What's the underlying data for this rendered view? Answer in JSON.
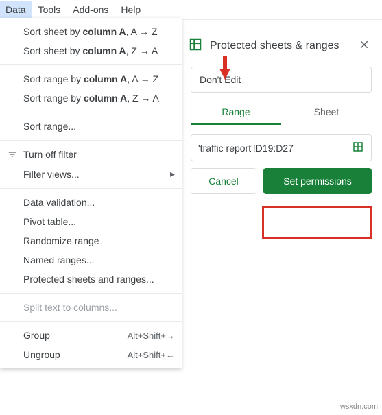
{
  "menubar": {
    "data": "Data",
    "tools": "Tools",
    "addons": "Add-ons",
    "help": "Help"
  },
  "menu": {
    "sort_sheet_az_pre": "Sort sheet by ",
    "sort_sheet_az_col": "column A",
    "sort_sheet_az_suf": ", A → Z",
    "sort_sheet_za_pre": "Sort sheet by ",
    "sort_sheet_za_col": "column A",
    "sort_sheet_za_suf": ", Z → A",
    "sort_range_az_pre": "Sort range by ",
    "sort_range_az_col": "column A",
    "sort_range_az_suf": ", A → Z",
    "sort_range_za_pre": "Sort range by ",
    "sort_range_za_col": "column A",
    "sort_range_za_suf": ", Z → A",
    "sort_range": "Sort range...",
    "turn_off_filter": "Turn off filter",
    "filter_views": "Filter views...",
    "data_validation": "Data validation...",
    "pivot_table": "Pivot table...",
    "randomize_range": "Randomize range",
    "named_ranges": "Named ranges...",
    "protected_sheets": "Protected sheets and ranges...",
    "split_text": "Split text to columns...",
    "group": "Group",
    "group_shortcut": "Alt+Shift+→",
    "ungroup": "Ungroup",
    "ungroup_shortcut": "Alt+Shift+←"
  },
  "panel": {
    "title": "Protected sheets & ranges",
    "description": "Don't Edit",
    "tab_range": "Range",
    "tab_sheet": "Sheet",
    "range_value": "'traffic report'!D19:D27",
    "cancel": "Cancel",
    "set_permissions": "Set permissions"
  },
  "watermark": "wsxdn.com"
}
